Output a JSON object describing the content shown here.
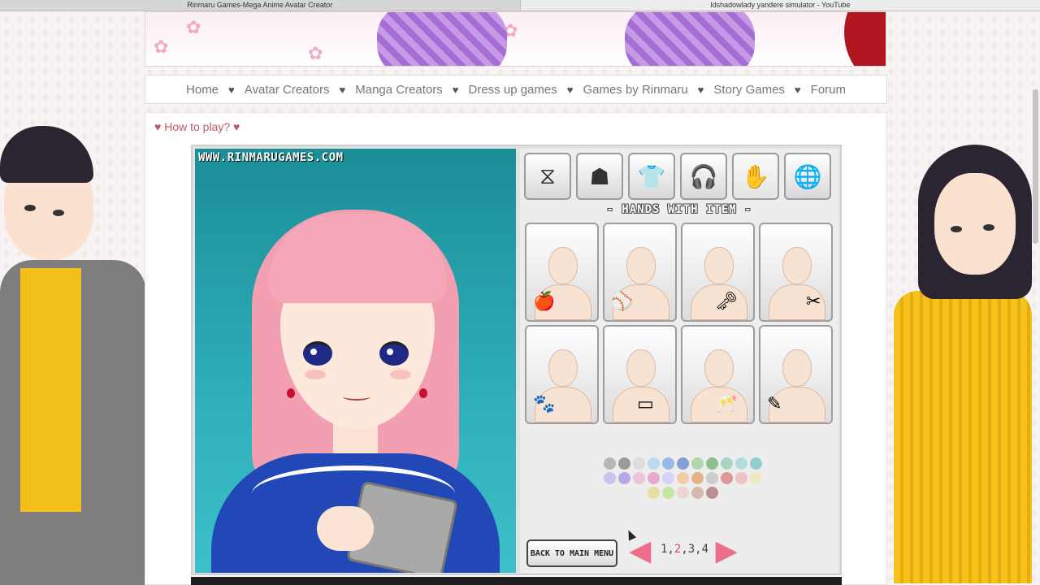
{
  "browser": {
    "tabs": [
      {
        "label": "Rinmaru Games-Mega Anime Avatar Creator"
      },
      {
        "label": "Idshadowlady yandere simulator - YouTube"
      }
    ]
  },
  "nav": {
    "items": [
      "Home",
      "Avatar Creators",
      "Manga Creators",
      "Dress up games",
      "Games by Rinmaru",
      "Story Games",
      "Forum"
    ],
    "separator": "♥"
  },
  "howto": {
    "label": "How to play?",
    "heart": "♥"
  },
  "game": {
    "watermark": "WWW.RINMARUGAMES.COM",
    "categories": [
      {
        "icon": "dna-icon",
        "glyph": "⧖"
      },
      {
        "icon": "hair-icon",
        "glyph": "☗"
      },
      {
        "icon": "shirt-icon",
        "glyph": "👕"
      },
      {
        "icon": "headphones-icon",
        "glyph": "🎧"
      },
      {
        "icon": "hand-icon",
        "glyph": "✋"
      },
      {
        "icon": "globe-icon",
        "glyph": "🌐"
      }
    ],
    "section_title": "- HANDS WITH ITEM -",
    "items": [
      {
        "prop": "🍎",
        "pos": "l"
      },
      {
        "prop": "⚾",
        "pos": "l"
      },
      {
        "prop": "🗝",
        "pos": "m"
      },
      {
        "prop": "✂",
        "pos": "r"
      },
      {
        "prop": "🐾",
        "pos": "l"
      },
      {
        "prop": "▭",
        "pos": "m"
      },
      {
        "prop": "🥂",
        "pos": "m"
      },
      {
        "prop": "✎",
        "pos": "l"
      }
    ],
    "swatch_colors": [
      "#8a8a8a",
      "#555555",
      "#d0d0d0",
      "#8fc7f0",
      "#4a8fe0",
      "#2f5fc0",
      "#7cc77c",
      "#3c9a3c",
      "#6fbf9f",
      "#7fd0d0",
      "#47b5b5",
      "#b2a0e8",
      "#8c6fe0",
      "#f0a0d0",
      "#e06fb0",
      "#c0c0ff",
      "#f5b070",
      "#e08030",
      "#b0b0b0",
      "#d05050",
      "#f0a0a0",
      "#f0e0a0",
      "#e0d060",
      "#a0e060",
      "#f0c0c0",
      "#c09080",
      "#904040"
    ],
    "back_button": "BACK TO MAIN MENU",
    "pages": {
      "prefix": "1,",
      "current": "2",
      "suffix": ",3,4"
    },
    "arrow_left": "◀",
    "arrow_right": "▶"
  }
}
